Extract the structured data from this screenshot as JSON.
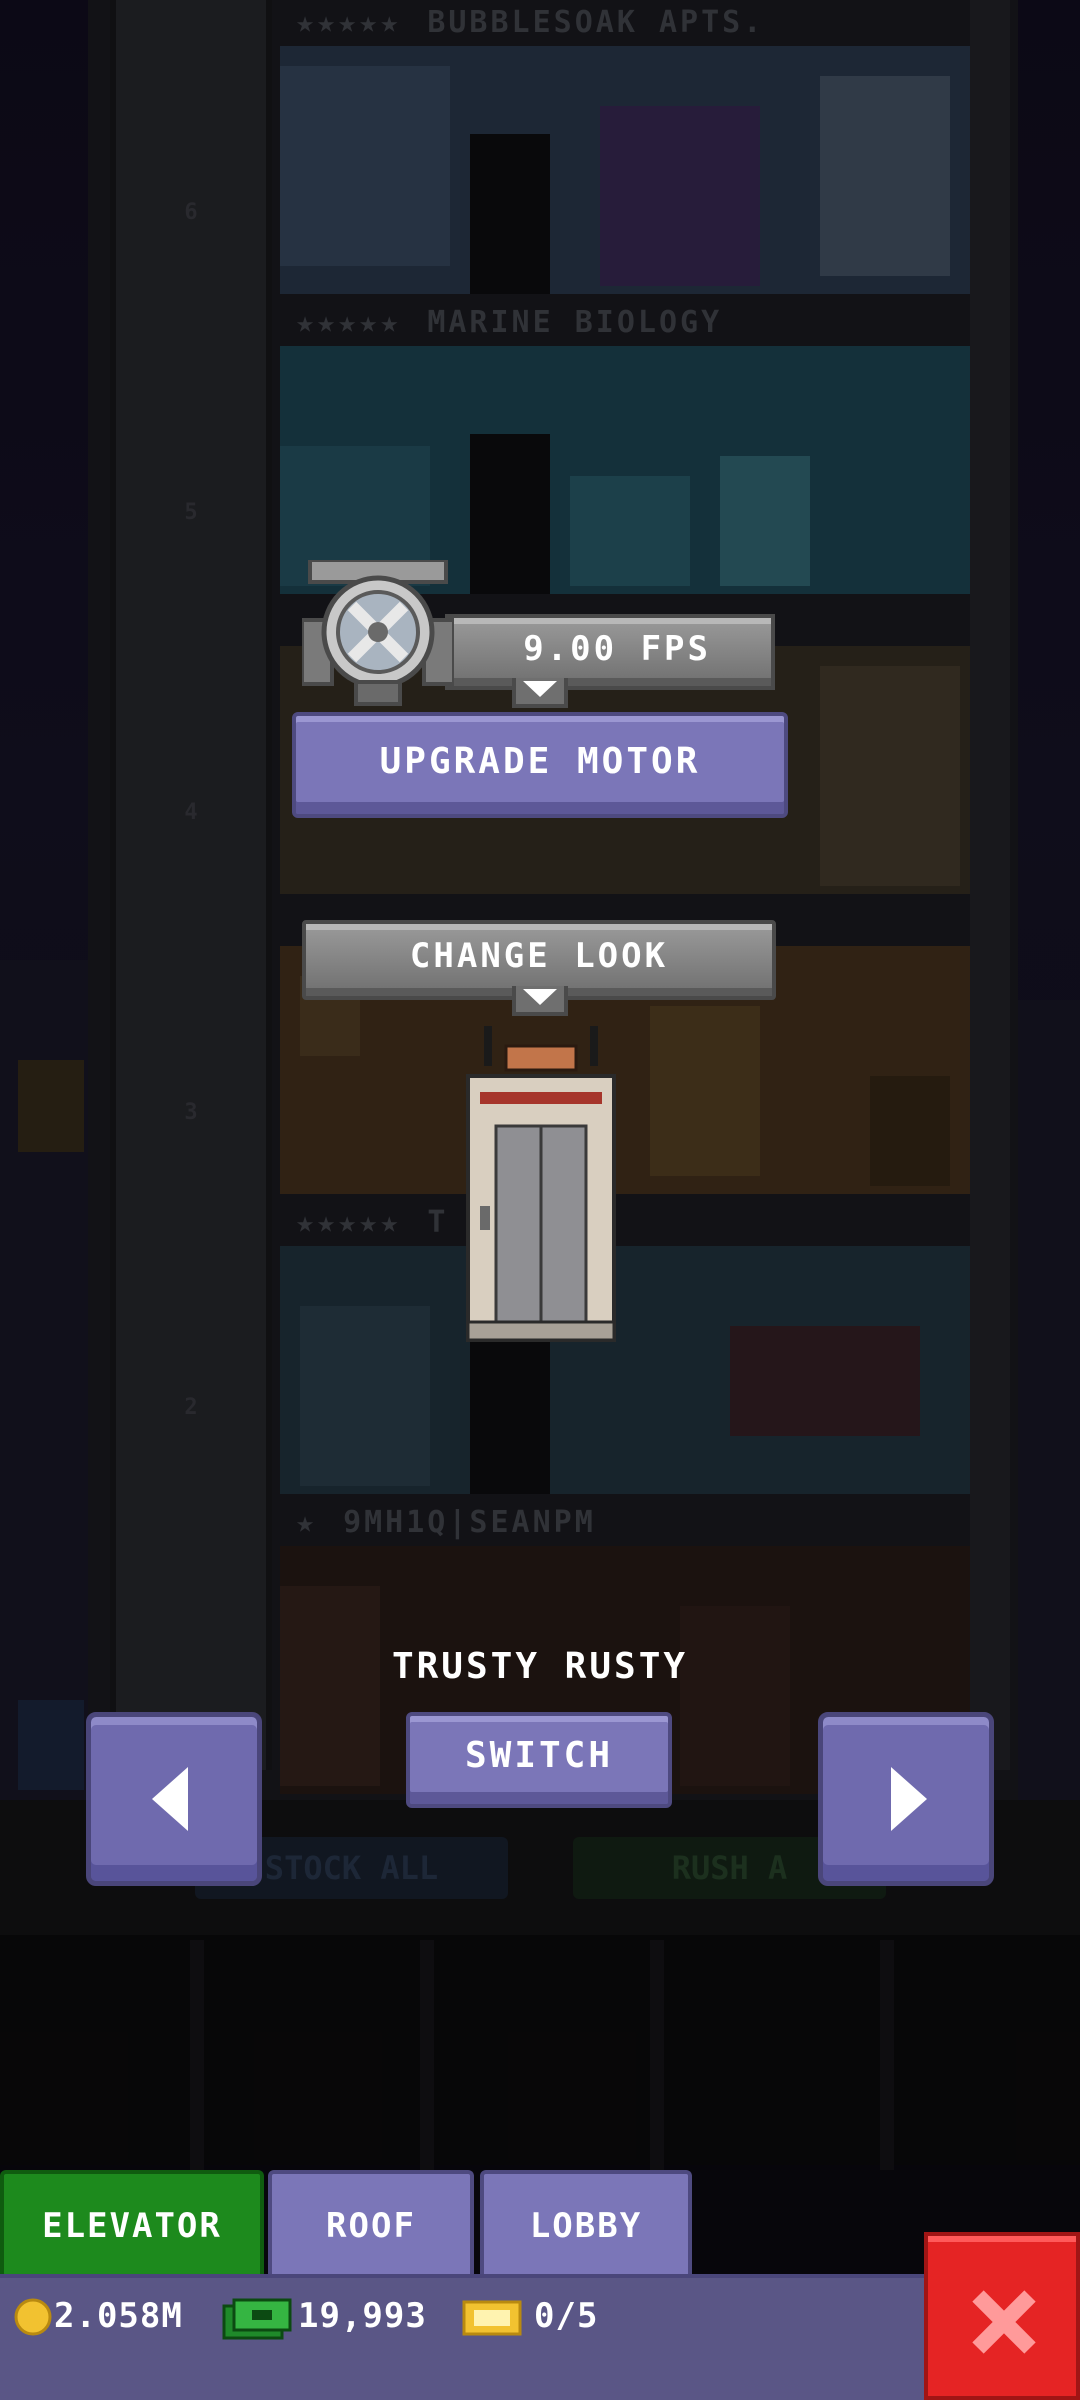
{
  "floors": [
    {
      "label": "BUBBLESOAK APTS.",
      "stars": "★★★★★"
    },
    {
      "label": "MARINE BIOLOGY",
      "stars": "★★★★★"
    },
    {
      "label": "",
      "stars": ""
    },
    {
      "label": "",
      "stars": ""
    },
    {
      "label": "T     OLOGY",
      "stars": "★★★★★"
    },
    {
      "label": "9MH1Q|SEANPM",
      "stars": "★"
    }
  ],
  "shaft_numbers": [
    "6",
    "5",
    "4",
    "3",
    "2"
  ],
  "elevator_panel": {
    "speed": "9.00 FPS",
    "upgrade_label": "UPGRADE MOTOR",
    "change_look_label": "CHANGE LOOK",
    "skin_name": "TRUSTY RUSTY",
    "switch_label": "SWITCH"
  },
  "background_buttons": {
    "stock_all": "STOCK ALL",
    "rush_all": "RUSH A"
  },
  "tabs": [
    {
      "label": "ELEVATOR",
      "active": true
    },
    {
      "label": "ROOF",
      "active": false
    },
    {
      "label": "LOBBY",
      "active": false
    }
  ],
  "status": {
    "coins": "2.058M",
    "bux": "19,993",
    "tickets": "0/5"
  },
  "colors": {
    "accent_purple": "#7b76b8",
    "active_tab_green": "#1d8a1d",
    "close_red": "#e52424"
  },
  "icons": [
    "coin-icon",
    "bux-icon",
    "ticket-icon",
    "close-x-icon",
    "arrow-left-icon",
    "arrow-right-icon",
    "motor-icon"
  ]
}
